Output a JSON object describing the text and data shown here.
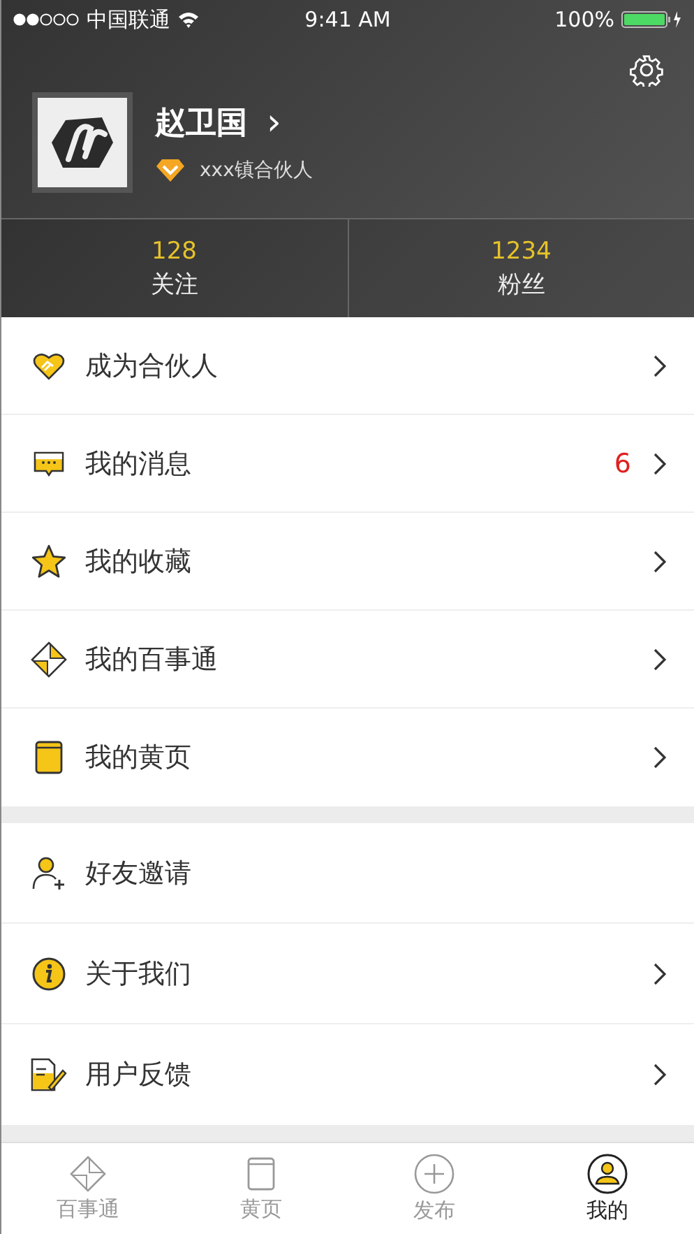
{
  "status_bar": {
    "carrier": "中国联通",
    "time": "9:41 AM",
    "battery": "100%"
  },
  "profile": {
    "name": "赵卫国",
    "name_chevron": "›",
    "role": "xxx镇合伙人"
  },
  "stats": [
    {
      "value": "128",
      "label": "关注"
    },
    {
      "value": "1234",
      "label": "粉丝"
    }
  ],
  "menu_groups": [
    [
      {
        "kind": "handshake",
        "label": "成为合伙人",
        "chevron": true
      },
      {
        "kind": "message",
        "label": "我的消息",
        "badge": "6",
        "chevron": true
      },
      {
        "kind": "star",
        "label": "我的收藏",
        "chevron": true
      },
      {
        "kind": "diamond",
        "label": "我的百事通",
        "chevron": true
      },
      {
        "kind": "book",
        "label": "我的黄页",
        "chevron": true
      }
    ],
    [
      {
        "kind": "invite",
        "label": "好友邀请",
        "chevron": false
      },
      {
        "kind": "info",
        "label": "关于我们",
        "chevron": true
      },
      {
        "kind": "feedback",
        "label": "用户反馈",
        "chevron": true
      }
    ]
  ],
  "tab_bar": [
    {
      "kind": "diamond",
      "label": "百事通",
      "selected": false
    },
    {
      "kind": "book",
      "label": "黄页",
      "selected": false
    },
    {
      "kind": "plus",
      "label": "发布",
      "selected": false
    },
    {
      "kind": "user",
      "label": "我的",
      "selected": true
    }
  ]
}
